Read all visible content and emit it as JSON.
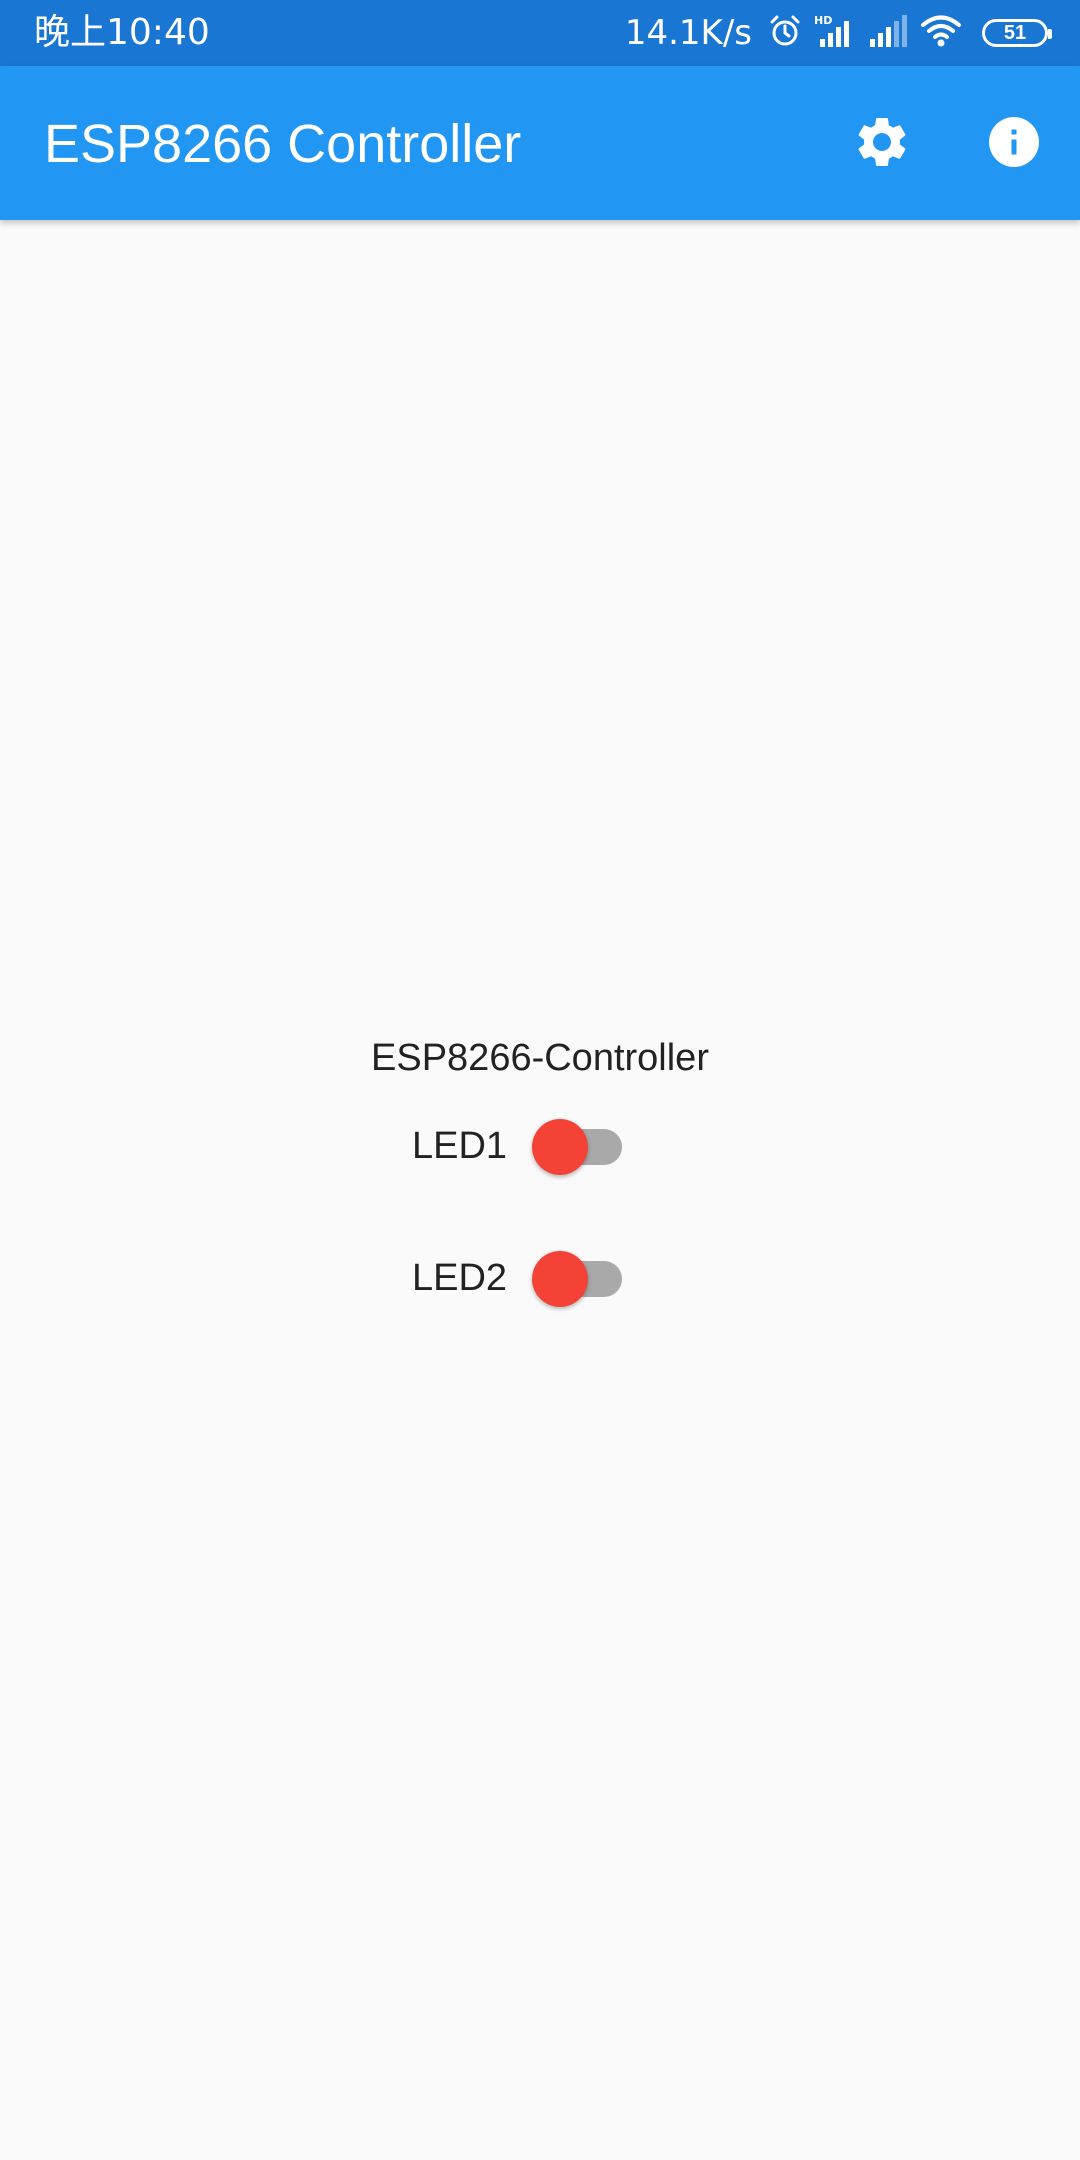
{
  "status_bar": {
    "time": "晚上10:40",
    "net_speed": "14.1K/s",
    "battery": "51",
    "icons": [
      "alarm-icon",
      "hd-signal-icon",
      "signal-icon",
      "wifi-icon",
      "battery-icon"
    ]
  },
  "app_bar": {
    "title": "ESP8266 Controller",
    "actions": [
      "settings-icon",
      "info-icon"
    ],
    "background": "#2196f3"
  },
  "content": {
    "title": "ESP8266-Controller",
    "leds": [
      {
        "label": "LED1",
        "on": false
      },
      {
        "label": "LED2",
        "on": false
      }
    ]
  },
  "colors": {
    "status_bar": "#1976d2",
    "app_bar": "#2196f3",
    "switch_thumb": "#f44336",
    "switch_track": "#a9a9a9",
    "background": "#fafafa"
  }
}
